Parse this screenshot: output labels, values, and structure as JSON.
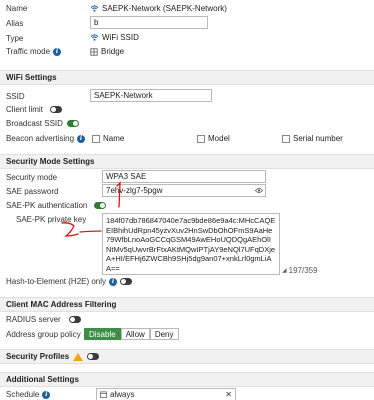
{
  "fields": {
    "name_label": "Name",
    "name_value": "SAEPK-Network (SAEPK-Network)",
    "alias_label": "Alias",
    "alias_value": "b",
    "type_label": "Type",
    "type_value": "WiFi SSID",
    "traffic_mode_label": "Traffic mode",
    "traffic_mode_value": "Bridge"
  },
  "wifi_settings": {
    "heading": "WiFi Settings",
    "ssid_label": "SSID",
    "ssid_value": "SAEPK-Network",
    "client_limit_label": "Client limit",
    "broadcast_ssid_label": "Broadcast SSID",
    "beacon_label": "Beacon advertising",
    "beacon_options": [
      "Name",
      "Model",
      "Serial number"
    ]
  },
  "security": {
    "heading": "Security Mode Settings",
    "mode_label": "Security mode",
    "mode_value": "WPA3 SAE",
    "password_label": "SAE password",
    "password_value": "7ehv-zlg7-5pgw",
    "sae_pk_label": "SAE-PK authentication",
    "private_key_label": "SAE-PK private key",
    "private_key_value": "184f07db786847040e7ac9bde86e9a4c:MHcCAQEEIBhihUdRpn45yzvXuv2HnSwDbOhOFmS9AaHe79WfbLnoAoGCCqGSM49AwEHoUQDQgAEhOlINtMv5qUwvrBrFtxAKtMQwIPTjAY9eNQl7UFqDXjeA+HI/EFHj6ZWCBh9SHj5dg9an07+xnkLrl0gmLiAA==",
    "char_count": "197/359",
    "h2e_label": "Hash-to-Element (H2E) only"
  },
  "mac_filter": {
    "heading": "Client MAC Address Filtering",
    "radius_label": "RADIUS server",
    "group_policy_label": "Address group policy",
    "policy_options": [
      "Disable",
      "Allow",
      "Deny"
    ],
    "policy_selected": "Disable"
  },
  "profiles": {
    "heading": "Security Profiles"
  },
  "additional": {
    "heading": "Additional Settings",
    "schedule_label": "Schedule",
    "schedule_value": "always"
  },
  "annotations": [
    "1",
    "2"
  ],
  "colors": {
    "toggle_on": "#2e7d32",
    "toggle_off": "#3b3b3b",
    "selected_button": "#3d8f46",
    "annotation_red": "#e01010",
    "section_bg": "#f1f1f1"
  }
}
